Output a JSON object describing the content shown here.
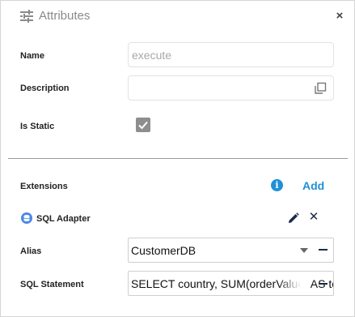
{
  "header": {
    "title": "Attributes",
    "close_label": "×",
    "title_icon": "tune-sliders-icon"
  },
  "fields": {
    "name_label": "Name",
    "name_value": "execute",
    "description_label": "Description",
    "description_value": "",
    "is_static_label": "Is Static",
    "is_static_checked": true
  },
  "extensions": {
    "label": "Extensions",
    "add_label": "Add",
    "info_icon_glyph": "i"
  },
  "adapter": {
    "label": "SQL Adapter",
    "remove_label": "✕",
    "alias_label": "Alias",
    "alias_value": "CustomerDB",
    "sql_label": "SQL Statement",
    "sql_value": "SELECT country, SUM(orderValue) AS total FROM orders"
  },
  "colors": {
    "accent": "#1e90d8",
    "checkbox": "#8e8e8e",
    "icon_dark": "#1b2a4a"
  }
}
